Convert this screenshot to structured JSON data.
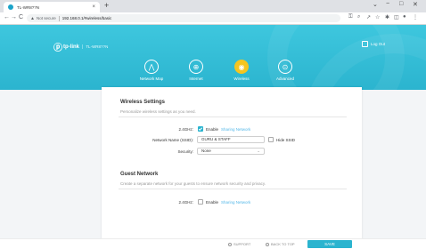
{
  "browser": {
    "tab_title": "TL-WR8??N",
    "new_tab": "+",
    "window_controls": [
      "⌄",
      "−",
      "□",
      "✕"
    ],
    "nav": {
      "back": "←",
      "forward": "→",
      "reload": "C"
    },
    "security_label": "Not secure",
    "url": "192.168.0.1/#wireless/basic"
  },
  "router": {
    "brand": "tp-link",
    "model": "TL-WR8??N",
    "logout_label": "Log Out",
    "nav": [
      {
        "label": "Network Map",
        "icon": "network-map-icon",
        "glyph": "⋀"
      },
      {
        "label": "Internet",
        "icon": "internet-globe-icon",
        "glyph": "⊕"
      },
      {
        "label": "Wireless",
        "icon": "wireless-icon",
        "glyph": "◉"
      },
      {
        "label": "Advanced",
        "icon": "advanced-settings-icon",
        "glyph": "⊙"
      }
    ],
    "active_tab": "Wireless"
  },
  "wireless": {
    "title": "Wireless Settings",
    "desc": "Personalize wireless settings as you need.",
    "band_label": "2.4GHz:",
    "enable_label": "Enable",
    "enable_checked": true,
    "sharing_label": "Sharing Network",
    "ssid_label": "Network Name (SSID):",
    "ssid_value": "GURU & STAFF",
    "hide_ssid_label": "Hide SSID",
    "security_label": "Security:",
    "security_value": "None"
  },
  "guest": {
    "title": "Guest Network",
    "desc": "Create a separate network for your guests to ensure network security and privacy.",
    "band_label": "2.4GHz:",
    "enable_label": "Enable",
    "enable_checked": false,
    "sharing_label": "Sharing Network"
  },
  "footer": {
    "support_label": "SUPPORT",
    "back_to_top_label": "BACK TO TOP",
    "save_label": "SAVE"
  },
  "colors": {
    "banner": "#2bb4cf",
    "active_tab": "#f5c520",
    "link": "#55b8e8",
    "save_button": "#2bb4cf"
  }
}
